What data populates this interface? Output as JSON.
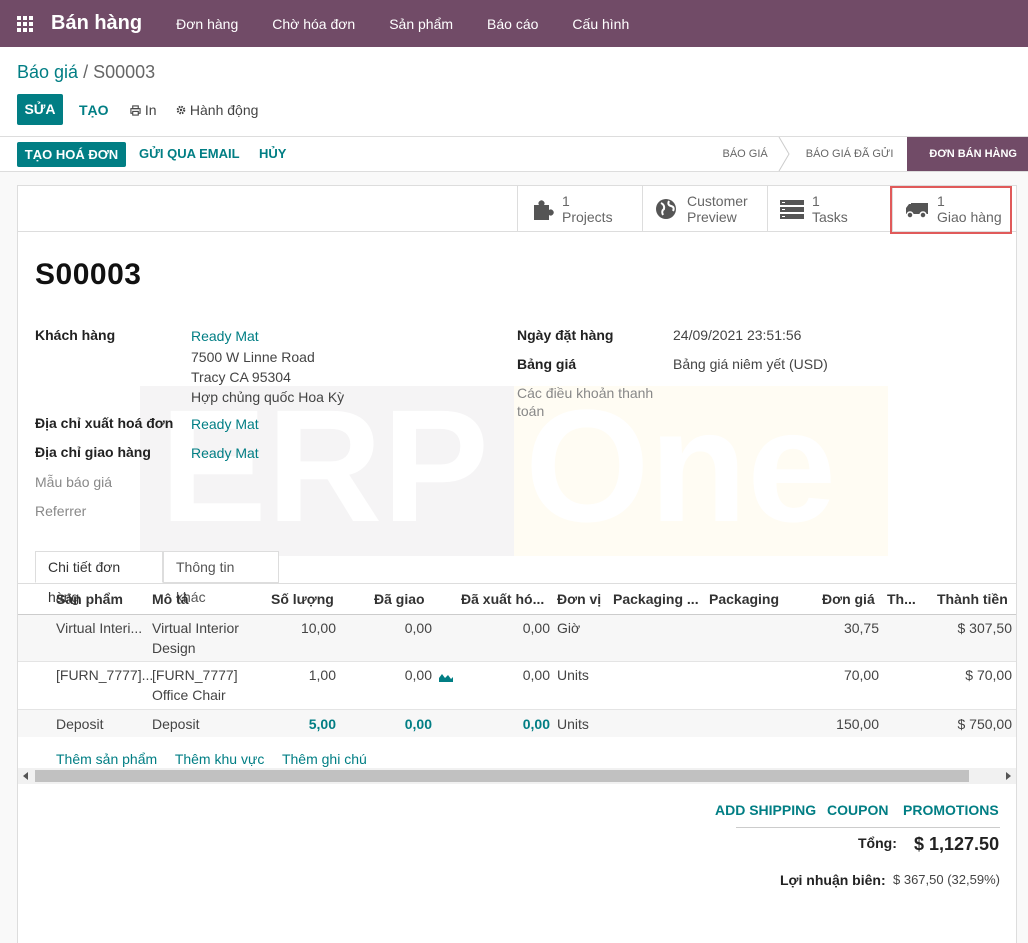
{
  "navbar": {
    "app_name": "Bán hàng",
    "items": [
      "Đơn hàng",
      "Chờ hóa đơn",
      "Sản phẩm",
      "Báo cáo",
      "Cấu hình"
    ]
  },
  "breadcrumb": {
    "parent": "Báo giá",
    "separator": "/",
    "current": "S00003"
  },
  "control": {
    "edit": "SỬA",
    "create": "TẠO",
    "print": "In",
    "action": "Hành động"
  },
  "statusbar": {
    "create_invoice": "TẠO HOÁ ĐƠN",
    "send_email": "GỬI QUA EMAIL",
    "cancel": "HỦY",
    "stages": [
      "BÁO GIÁ",
      "BÁO GIÁ ĐÃ GỬI",
      "ĐƠN BÁN HÀNG"
    ],
    "active_stage": "ĐƠN BÁN HÀNG"
  },
  "smart_buttons": [
    {
      "icon": "puzzle-icon",
      "line1": "1",
      "line2": "Projects"
    },
    {
      "icon": "globe-icon",
      "line1": "Customer",
      "line2": "Preview"
    },
    {
      "icon": "tasks-icon",
      "line1": "1",
      "line2": "Tasks"
    },
    {
      "icon": "truck-icon",
      "line1": "1",
      "line2": "Giao hàng"
    }
  ],
  "record": {
    "name": "S00003",
    "customer_label": "Khách hàng",
    "customer_name": "Ready Mat",
    "address1": "7500 W Linne Road",
    "address2": "Tracy CA 95304",
    "address3": "Hợp chủng quốc Hoa Kỳ",
    "invoice_addr_label": "Địa chỉ xuất hoá đơn",
    "invoice_addr": "Ready Mat",
    "delivery_addr_label": "Địa chỉ giao hàng",
    "delivery_addr": "Ready Mat",
    "template_label": "Mẫu báo giá",
    "referrer_label": "Referrer",
    "order_date_label": "Ngày đặt hàng",
    "order_date": "24/09/2021 23:51:56",
    "pricelist_label": "Bảng giá",
    "pricelist": "Bảng giá niêm yết (USD)",
    "payment_terms_label_1": "Các điều khoản thanh",
    "payment_terms_label_2": "toán"
  },
  "watermark": {
    "left": "ERP",
    "right": "One"
  },
  "tabs": [
    "Chi tiết đơn hàng",
    "Thông tin khác"
  ],
  "table": {
    "headers": [
      "Sản phẩm",
      "Mô tả",
      "Số lượng",
      "Đã giao",
      "Đã xuất hó...",
      "Đơn vị",
      "Packaging ...",
      "Packaging",
      "Đơn giá",
      "Th...",
      "Thành tiền"
    ],
    "rows": [
      {
        "product": "Virtual Interi...",
        "desc1": "Virtual Interior",
        "desc2": "Design",
        "qty": "10,00",
        "delivered": "0,00",
        "invoiced": "0,00",
        "uom": "Giờ",
        "price": "30,75",
        "subtotal": "$ 307,50"
      },
      {
        "product": "[FURN_7777]...",
        "desc1": "[FURN_7777]",
        "desc2": "Office Chair",
        "qty": "1,00",
        "delivered": "0,00",
        "invoiced": "0,00",
        "uom": "Units",
        "price": "70,00",
        "subtotal": "$ 70,00"
      },
      {
        "product": "Deposit",
        "desc1": "Deposit",
        "desc2": "",
        "qty": "5,00",
        "delivered": "0,00",
        "invoiced": "0,00",
        "uom": "Units",
        "price": "150,00",
        "subtotal": "$ 750,00"
      }
    ],
    "add_links": [
      "Thêm sản phẩm",
      "Thêm khu vực",
      "Thêm ghi chú"
    ]
  },
  "footer": {
    "add_shipping": "ADD SHIPPING",
    "coupon": "COUPON",
    "promotions": "PROMOTIONS",
    "total_label": "Tổng:",
    "total_value": "$ 1,127.50",
    "margin_label": "Lợi nhuận biên:",
    "margin_value": "$ 367,50 (32,59%)"
  },
  "colors": {
    "brand": "#714b67",
    "accent": "#017e84",
    "highlight": "#e05a5a"
  }
}
